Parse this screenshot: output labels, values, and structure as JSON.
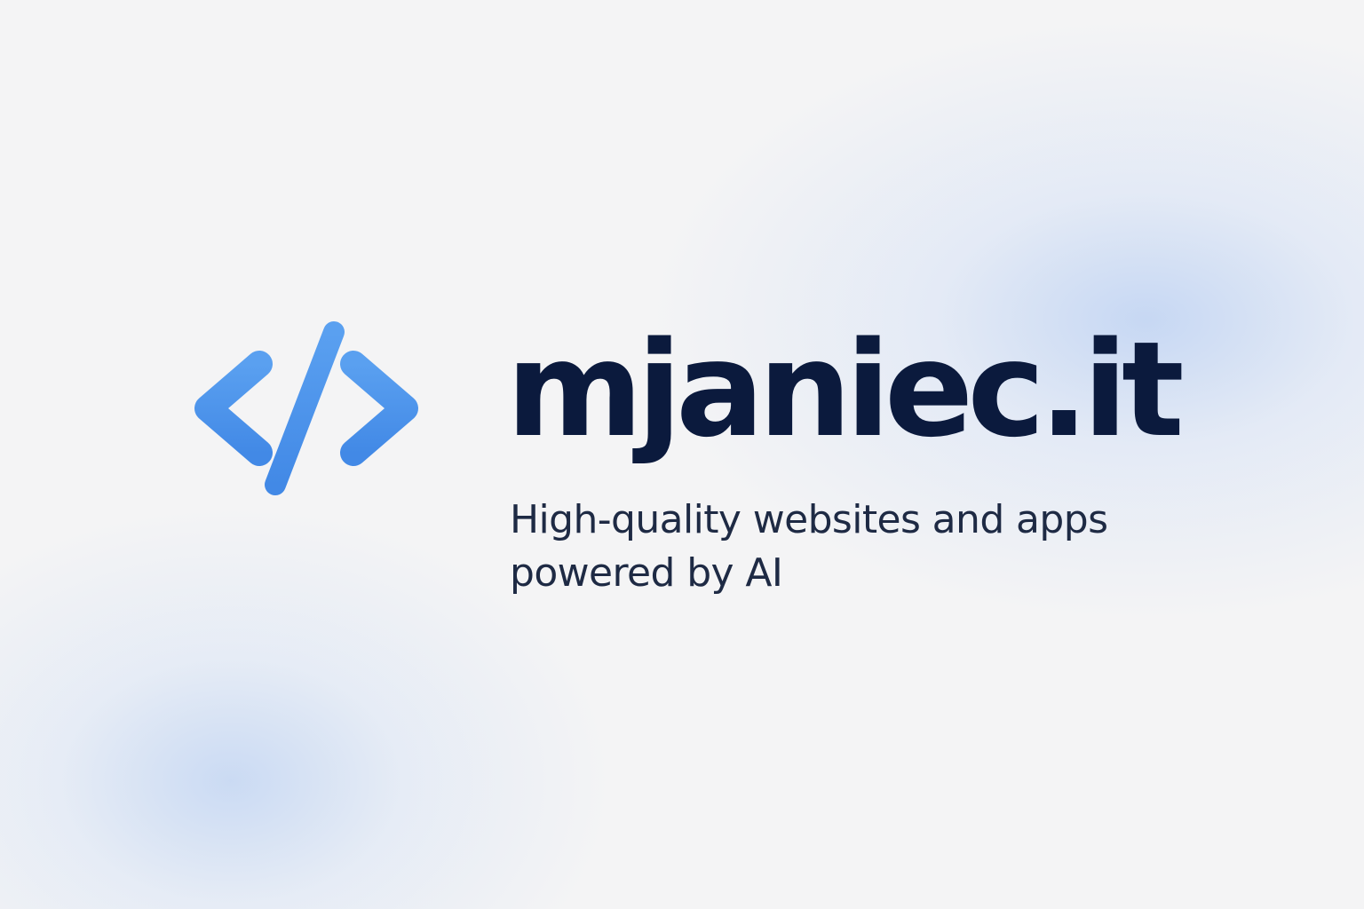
{
  "brand": {
    "name": "mjaniec.it",
    "logo_icon": "code-brackets-icon",
    "accent_color": "#4c93ec",
    "text_color": "#0b1a3d"
  },
  "tagline": {
    "line1": "High-quality websites and apps",
    "line2": "powered by AI"
  }
}
